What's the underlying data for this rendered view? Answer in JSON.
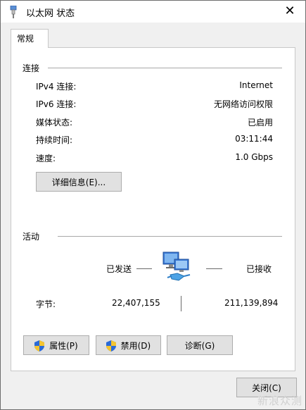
{
  "window": {
    "title": "以太网 状态",
    "close_symbol": "✕"
  },
  "tab": {
    "label": "常规"
  },
  "connection": {
    "section_title": "连接",
    "rows": [
      {
        "label": "IPv4 连接:",
        "value": "Internet"
      },
      {
        "label": "IPv6 连接:",
        "value": "无网络访问权限"
      },
      {
        "label": "媒体状态:",
        "value": "已启用"
      },
      {
        "label": "持续时间:",
        "value": "03:11:44"
      },
      {
        "label": "速度:",
        "value": "1.0 Gbps"
      }
    ],
    "details_button": "详细信息(E)..."
  },
  "activity": {
    "section_title": "活动",
    "sent_label": "已发送",
    "received_label": "已接收",
    "bytes_label": "字节:",
    "bytes_sent": "22,407,155",
    "bytes_received": "211,139,894"
  },
  "buttons": {
    "properties": "属性(P)",
    "disable": "禁用(D)",
    "diagnose": "诊断(G)",
    "close": "关闭(C)"
  },
  "watermark": "新浪众测",
  "colors": {
    "shield_blue": "#2a6ad8",
    "shield_yellow": "#f4c430"
  }
}
